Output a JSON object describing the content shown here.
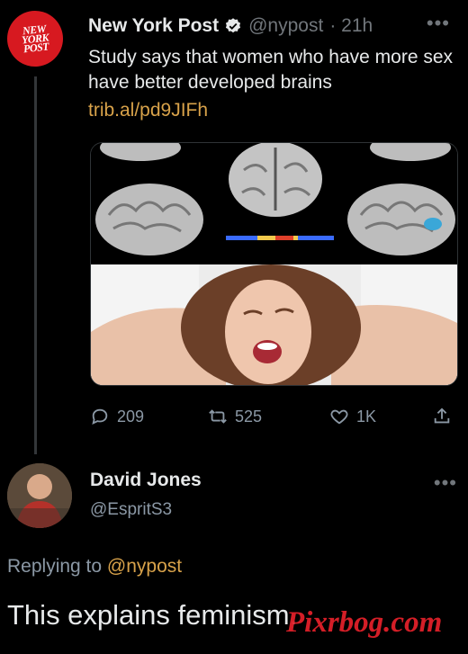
{
  "tweet": {
    "author_name": "New York Post",
    "author_handle": "@nypost",
    "time": "· 21h",
    "avatar_lines": [
      "NEW",
      "YORK",
      "POST"
    ],
    "text": "Study says that women who have more sex have better developed brains",
    "link": "trib.al/pd9JIFh",
    "replies": "209",
    "retweets": "525",
    "likes": "1K"
  },
  "reply": {
    "author_name": "David Jones",
    "author_handle": "@EspritS3",
    "replying_prefix": "Replying to",
    "replying_mention": "@nypost",
    "text": "This explains feminism."
  },
  "watermark": "Pixrbog.com",
  "colors": {
    "background": "#000000",
    "link_accent": "#d8a24a",
    "muted": "#8b98a5",
    "brand_red": "#d71920"
  }
}
